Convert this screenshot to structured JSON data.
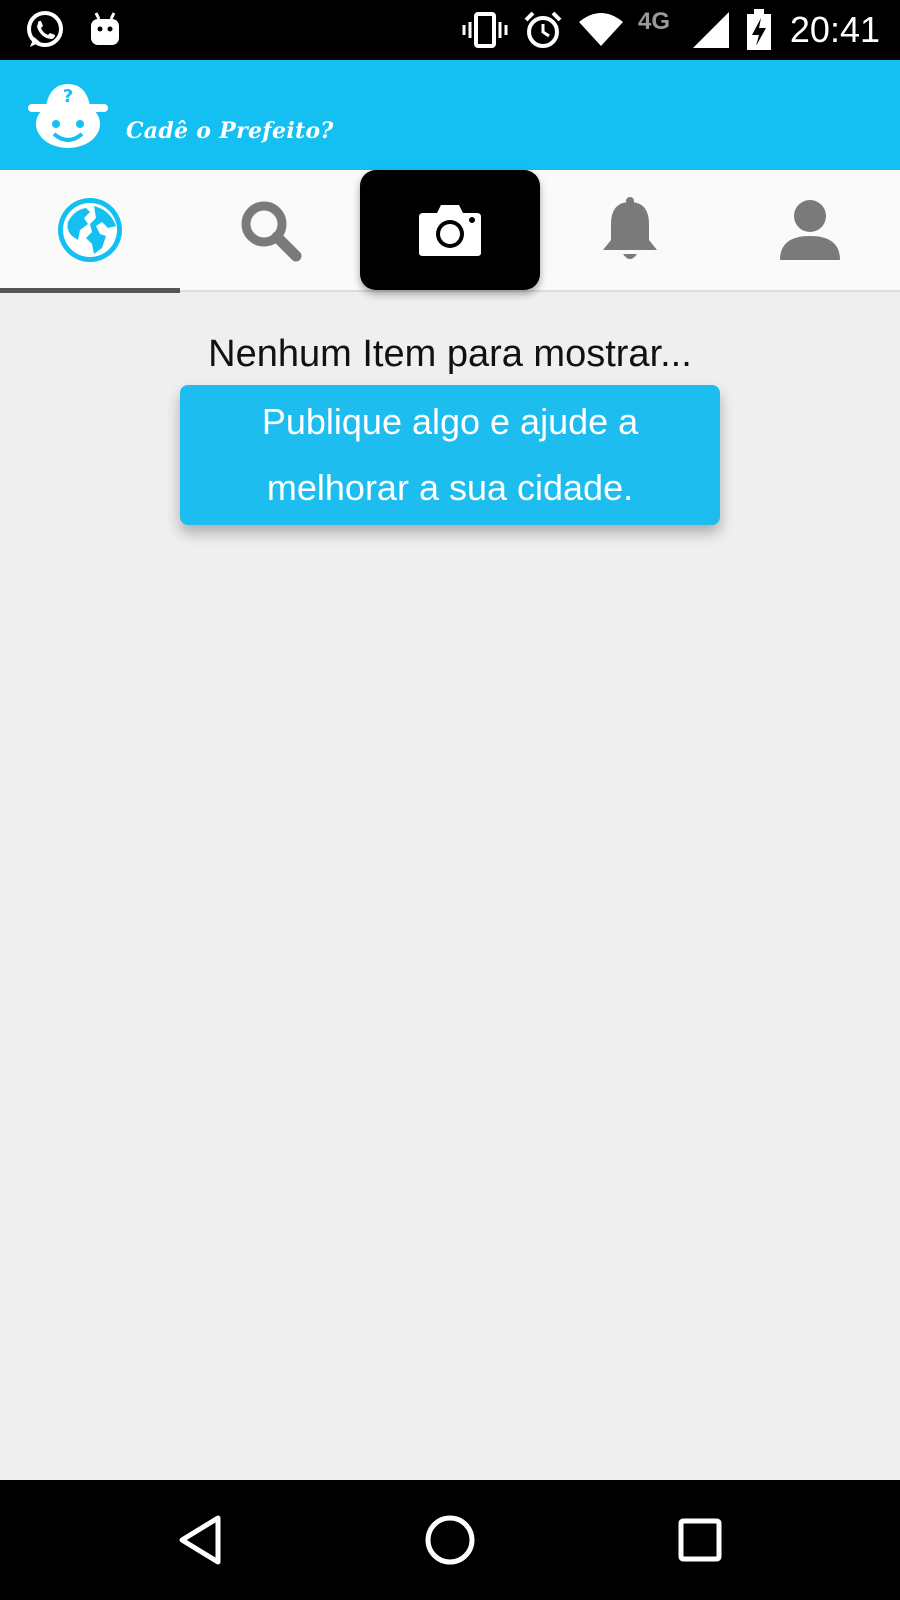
{
  "status_bar": {
    "time": "20:41",
    "network": "4G",
    "icons": [
      "whatsapp-icon",
      "android-icon",
      "vibrate-icon",
      "alarm-icon",
      "wifi-icon",
      "signal-icon",
      "battery-icon"
    ]
  },
  "header": {
    "app_title": "Cadê o Prefeito?",
    "brand_color": "#14c0f2"
  },
  "tabs": [
    {
      "name": "feed",
      "icon": "globe-icon",
      "active": true,
      "color": "#14c0f2"
    },
    {
      "name": "search",
      "icon": "search-icon",
      "active": false,
      "color": "#7a7a7a"
    },
    {
      "name": "camera",
      "icon": "camera-icon",
      "active": false,
      "color": "#ffffff"
    },
    {
      "name": "notifications",
      "icon": "bell-icon",
      "active": false,
      "color": "#7a7a7a"
    },
    {
      "name": "profile",
      "icon": "person-icon",
      "active": false,
      "color": "#7a7a7a"
    }
  ],
  "content": {
    "empty_message": "Nenhum Item para mostrar...",
    "cta_line1": "Publique algo e ajude a",
    "cta_line2": "melhorar a sua cidade."
  },
  "navigation": {
    "icons": [
      "back-icon",
      "home-icon",
      "recents-icon"
    ]
  }
}
